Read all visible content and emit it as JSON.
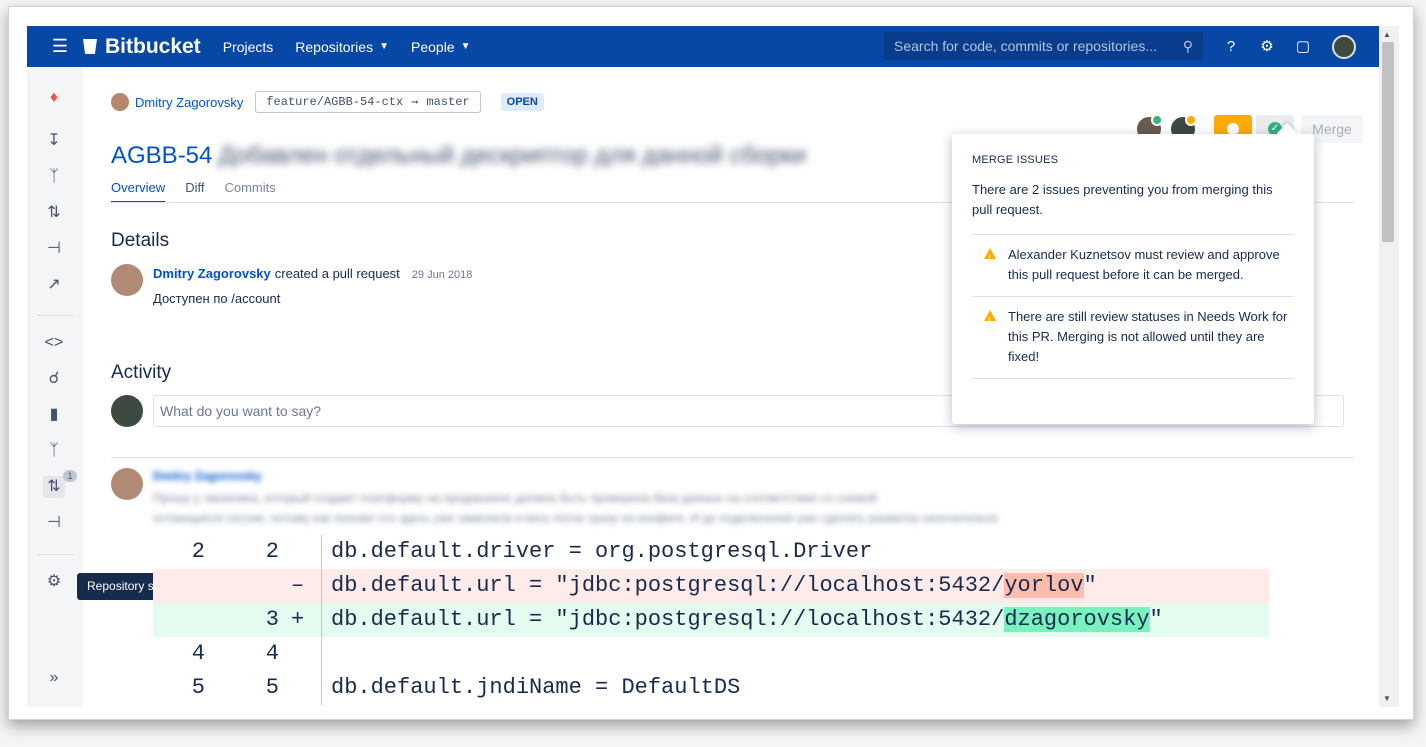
{
  "nav": {
    "logo": "Bitbucket",
    "links": [
      "Projects",
      "Repositories",
      "People"
    ],
    "search_placeholder": "Search for code, commits or repositories..."
  },
  "sidebar": {
    "icons": [
      "project-logo-icon",
      "create-icon",
      "branches-icon",
      "pull-requests-icon",
      "forks-icon",
      "insights-icon",
      "source-icon",
      "commits-icon",
      "stats-icon",
      "repo-branches-icon",
      "repo-pull-requests-icon",
      "repo-forks-icon",
      "settings-icon",
      "expand-icon"
    ],
    "pr_badge": "1",
    "tooltip": "Repository settings"
  },
  "pr": {
    "author": "Dmitry Zagorovsky",
    "source_branch": "feature/AGBB-54-ctx",
    "target_branch": "master",
    "status": "OPEN",
    "key": "AGBB-54",
    "title_rest": "Добавлен отдельный дескриптор для данной сборки",
    "tabs": [
      "Overview",
      "Diff",
      "Commits"
    ],
    "merge_label": "Merge"
  },
  "details": {
    "heading": "Details",
    "author": "Dmitry Zagorovsky",
    "action": "created a pull request",
    "date": "29 Jun 2018",
    "description": "Доступен по /account"
  },
  "activity": {
    "heading": "Activity",
    "comment_placeholder": "What do you want to say?",
    "blurred_author": "Dmitry Zagorovsky",
    "blurred_line1": "Прошу у заказчика, который создает платформу на продакшене должна быть проверена база данных на соответствие со схемой",
    "blurred_line2": "остающиеся сессии, потому как похоже что здесь уже заменили и весь поток сразу на конфиге. И до подключения уже сделать разметку окончательно"
  },
  "diff": [
    {
      "type": "ctx",
      "old": "2",
      "new": "2",
      "sign": "",
      "pre": "db.default.driver = org.postgresql.Driver",
      "hl": "",
      "post": ""
    },
    {
      "type": "del",
      "old": "",
      "new": "",
      "sign": "–",
      "pre": "db.default.url = \"jdbc:postgresql://localhost:5432/",
      "hl": "yorlov",
      "post": "\""
    },
    {
      "type": "add",
      "old": "",
      "new": "3",
      "sign": "+",
      "pre": "db.default.url = \"jdbc:postgresql://localhost:5432/",
      "hl": "dzagorovsky",
      "post": "\""
    },
    {
      "type": "ctx",
      "old": "4",
      "new": "4",
      "sign": "",
      "pre": "",
      "hl": "",
      "post": ""
    },
    {
      "type": "ctx",
      "old": "5",
      "new": "5",
      "sign": "",
      "pre": "db.default.jndiName = DefaultDS",
      "hl": "",
      "post": ""
    }
  ],
  "merge_issues": {
    "title": "MERGE ISSUES",
    "intro": "There are 2 issues preventing you from merging this pull request.",
    "issues": [
      "Alexander Kuznetsov must review and approve this pull request before it can be merged.",
      "There are still review statuses in Needs Work for this PR. Merging is not allowed until they are fixed!"
    ]
  },
  "colors": {
    "nav": "#0747a6",
    "link": "#0052cc",
    "needs_work": "#ffab00",
    "approved": "#36b37e",
    "deleted_row": "#ffebe9",
    "added_row": "#e3fcef"
  }
}
